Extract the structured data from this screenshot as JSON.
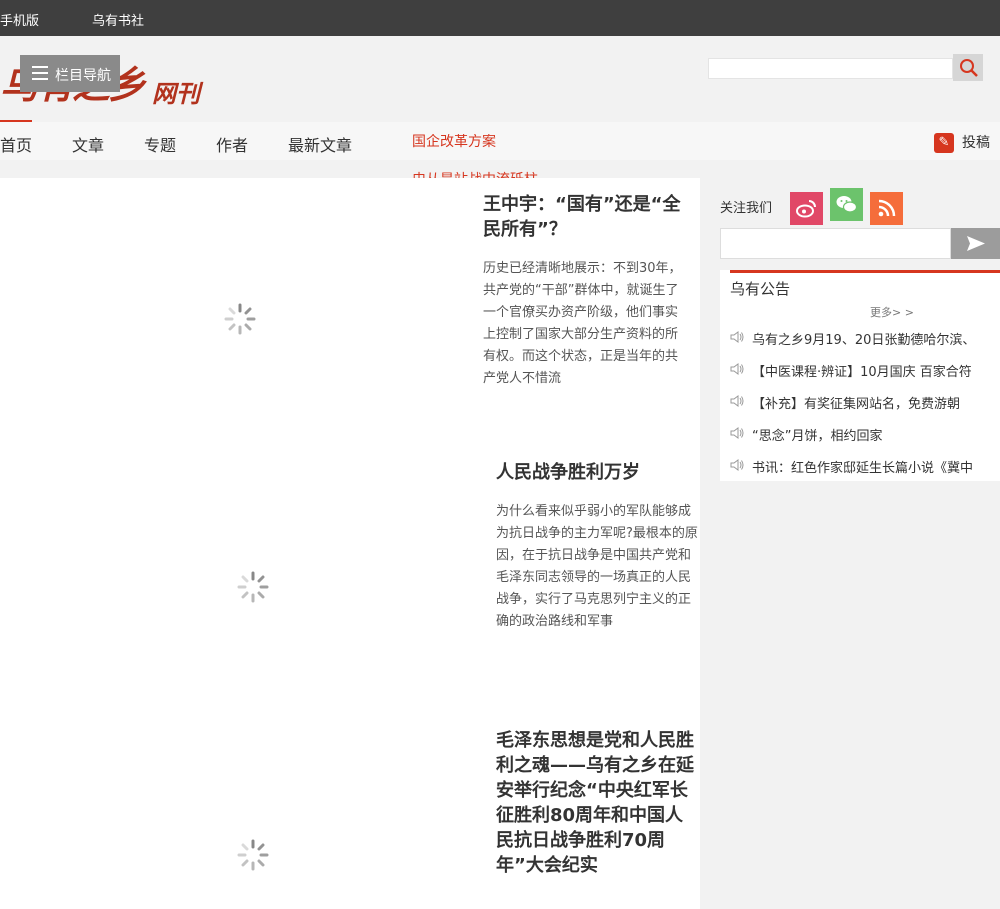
{
  "topbar": {
    "mobile": "手机版",
    "bookstore": "乌有书社"
  },
  "header": {
    "logo_text": "乌有之乡",
    "logo_sub": "网刊",
    "nav_button": "栏目导航",
    "search_placeholder": ""
  },
  "nav": {
    "items": [
      "首页",
      "文章",
      "专题",
      "作者",
      "最新文章"
    ],
    "ticker": [
      "国企改革方案",
      "史从是站战中流砥柱"
    ],
    "contribute": "投稿"
  },
  "articles": [
    {
      "title": "王中宇：“国有”还是“全民所有”？",
      "summary": "历史已经清晰地展示：不到30年，共产党的“干部”群体中，就诞生了一个官僚买办资产阶级，他们事实上控制了国家大部分生产资料的所有权。而这个状态，正是当年的共产党人不惜流"
    },
    {
      "title": "人民战争胜利万岁",
      "summary": "为什么看来似乎弱小的军队能够成为抗日战争的主力军呢?最根本的原因，在于抗日战争是中国共产党和毛泽东同志领导的一场真正的人民战争，实行了马克思列宁主义的正确的政治路线和军事"
    },
    {
      "title": "毛泽东思想是党和人民胜利之魂——乌有之乡在延安举行纪念“中央红军长征胜利80周年和中国人民抗日战争胜利70周年”大会纪实",
      "summary": ""
    }
  ],
  "sidebar": {
    "follow_label": "关注我们",
    "subscribe_placeholder": "",
    "notice_title": "乌有公告",
    "more": "更多> >",
    "notices": [
      "乌有之乡9月19、20日张勤德哈尔滨、",
      "【中医课程·辨证】10月国庆 百家合符",
      "【补充】有奖征集网站名，免费游朝",
      "“思念”月饼，相约回家",
      "书讯：红色作家邸延生长篇小说《冀中"
    ]
  },
  "colors": {
    "accent": "#d6361f",
    "topbar": "#3f3f3f",
    "logo": "#b2321d"
  }
}
